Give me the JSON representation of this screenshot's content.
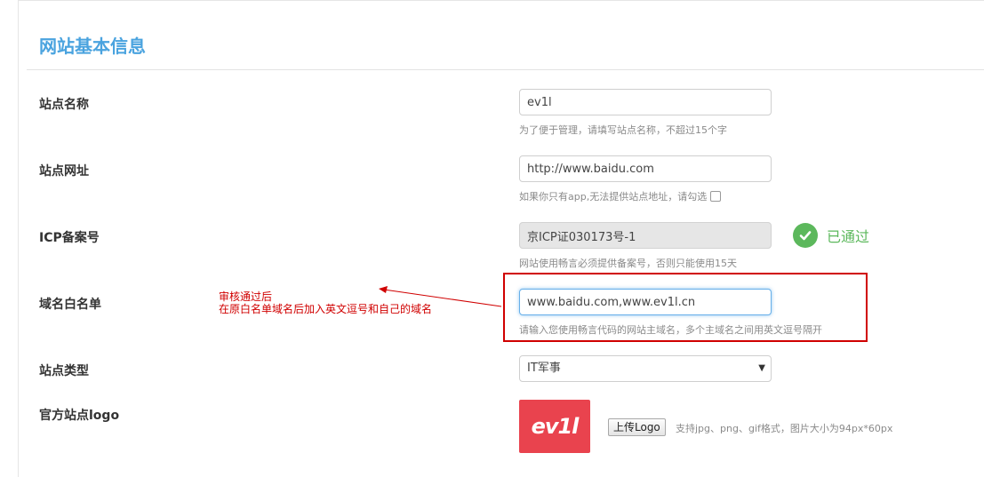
{
  "section": {
    "title": "网站基本信息"
  },
  "fields": {
    "site_name": {
      "label": "站点名称",
      "value": "ev1l",
      "hint": "为了便于管理，请填写站点名称，不超过15个字"
    },
    "site_url": {
      "label": "站点网址",
      "value": "http://www.baidu.com",
      "hint": "如果你只有app,无法提供站点地址，请勾选"
    },
    "icp": {
      "label": "ICP备案号",
      "value": "京ICP证030173号-1",
      "status": "已通过",
      "hint": "网站使用畅言必须提供备案号，否则只能使用15天"
    },
    "domain_whitelist": {
      "label": "域名白名单",
      "value": "www.baidu.com,www.ev1l.cn",
      "hint": "请输入您使用畅言代码的网站主域名，多个主域名之间用英文逗号隔开"
    },
    "site_type": {
      "label": "站点类型",
      "selected": "IT军事"
    },
    "logo": {
      "label": "官方站点logo",
      "logo_text": "ev1l",
      "upload_label": "上传Logo",
      "upload_hint": "支持jpg、png、gif格式，图片大小为94px*60px"
    }
  },
  "annotation": {
    "line1": "审核通过后",
    "line2": "在原白名单域名后加入英文逗号和自己的域名"
  },
  "colors": {
    "title_blue": "#4aa3df",
    "passed_green": "#5cb85c",
    "annotation_red": "#d00000",
    "logo_red": "#e9434e"
  },
  "icons": {
    "passed": "check-circle-icon",
    "select": "triangle-down-icon"
  }
}
